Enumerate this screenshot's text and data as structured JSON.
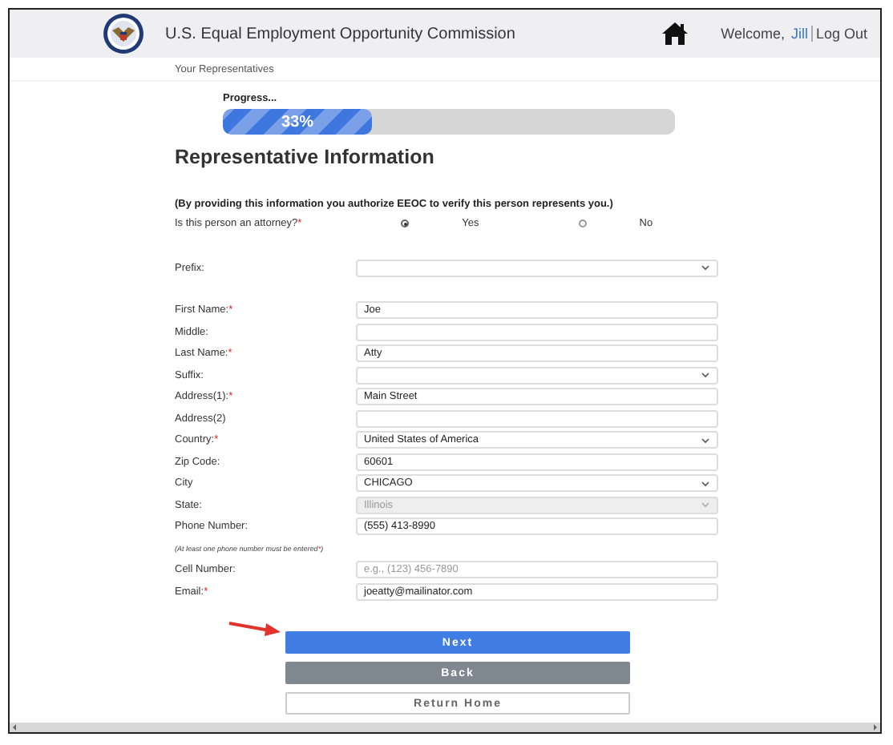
{
  "header": {
    "title": "U.S. Equal Employment Opportunity Commission",
    "welcome": "Welcome,",
    "user": "Jill",
    "logout": "Log Out"
  },
  "breadcrumb": "Your Representatives",
  "progress": {
    "label": "Progress...",
    "level": 0.33,
    "reading": "33%"
  },
  "heading": "Representative Information",
  "notice": "(By providing this information you authorize EEOC to verify this person represents you.)",
  "attorney": {
    "label": "Is this person an attorney?",
    "required_mark": "*",
    "options": [
      {
        "label": "Yes",
        "selected": true
      },
      {
        "label": "No",
        "selected": false
      }
    ]
  },
  "sections": [
    {
      "fields": [
        {
          "label": "Prefix:",
          "kind": "select",
          "disabled": false
        }
      ]
    },
    {
      "fields": [
        {
          "label": "First Name:",
          "required_mark": "*",
          "kind": "text",
          "value": "Joe",
          "disabled": false
        },
        {
          "label": "Middle:",
          "kind": "text",
          "disabled": false
        },
        {
          "label": "Last Name:",
          "required_mark": "*",
          "kind": "text",
          "value": "Atty",
          "disabled": false
        },
        {
          "label": "Suffix:",
          "kind": "select",
          "disabled": false
        },
        {
          "label": "Address(1):",
          "required_mark": "*",
          "kind": "text",
          "value": "Main Street",
          "disabled": false
        },
        {
          "label": "Address(2)",
          "kind": "text",
          "disabled": false
        },
        {
          "label": "Country:",
          "required_mark": "*",
          "kind": "select",
          "value": "United States of America",
          "disabled": false
        },
        {
          "label": "Zip Code:",
          "kind": "text",
          "value": "60601",
          "disabled": false
        },
        {
          "label": "City",
          "kind": "select",
          "value": "CHICAGO",
          "disabled": false
        },
        {
          "label": "State:",
          "kind": "select",
          "value": "Illinois",
          "disabled": true
        },
        {
          "label": "Phone Number:",
          "kind": "text",
          "value": "(555) 413-8990",
          "disabled": false
        },
        {
          "kind": "note",
          "text": "(At least one phone number must be entered",
          "mark": "*",
          "end": ")"
        },
        {
          "label": "Cell Number:",
          "kind": "text",
          "placeholder": "e.g., (123) 456-7890",
          "disabled": false
        },
        {
          "label": "Email:",
          "required_mark": "*",
          "kind": "text",
          "value": "joeatty@mailinator.com",
          "disabled": false
        }
      ]
    }
  ],
  "buttons": [
    {
      "label": "Next",
      "kind": "primary"
    },
    {
      "label": "Back",
      "kind": "secondary"
    },
    {
      "label": "Return Home",
      "kind": "outline"
    }
  ]
}
